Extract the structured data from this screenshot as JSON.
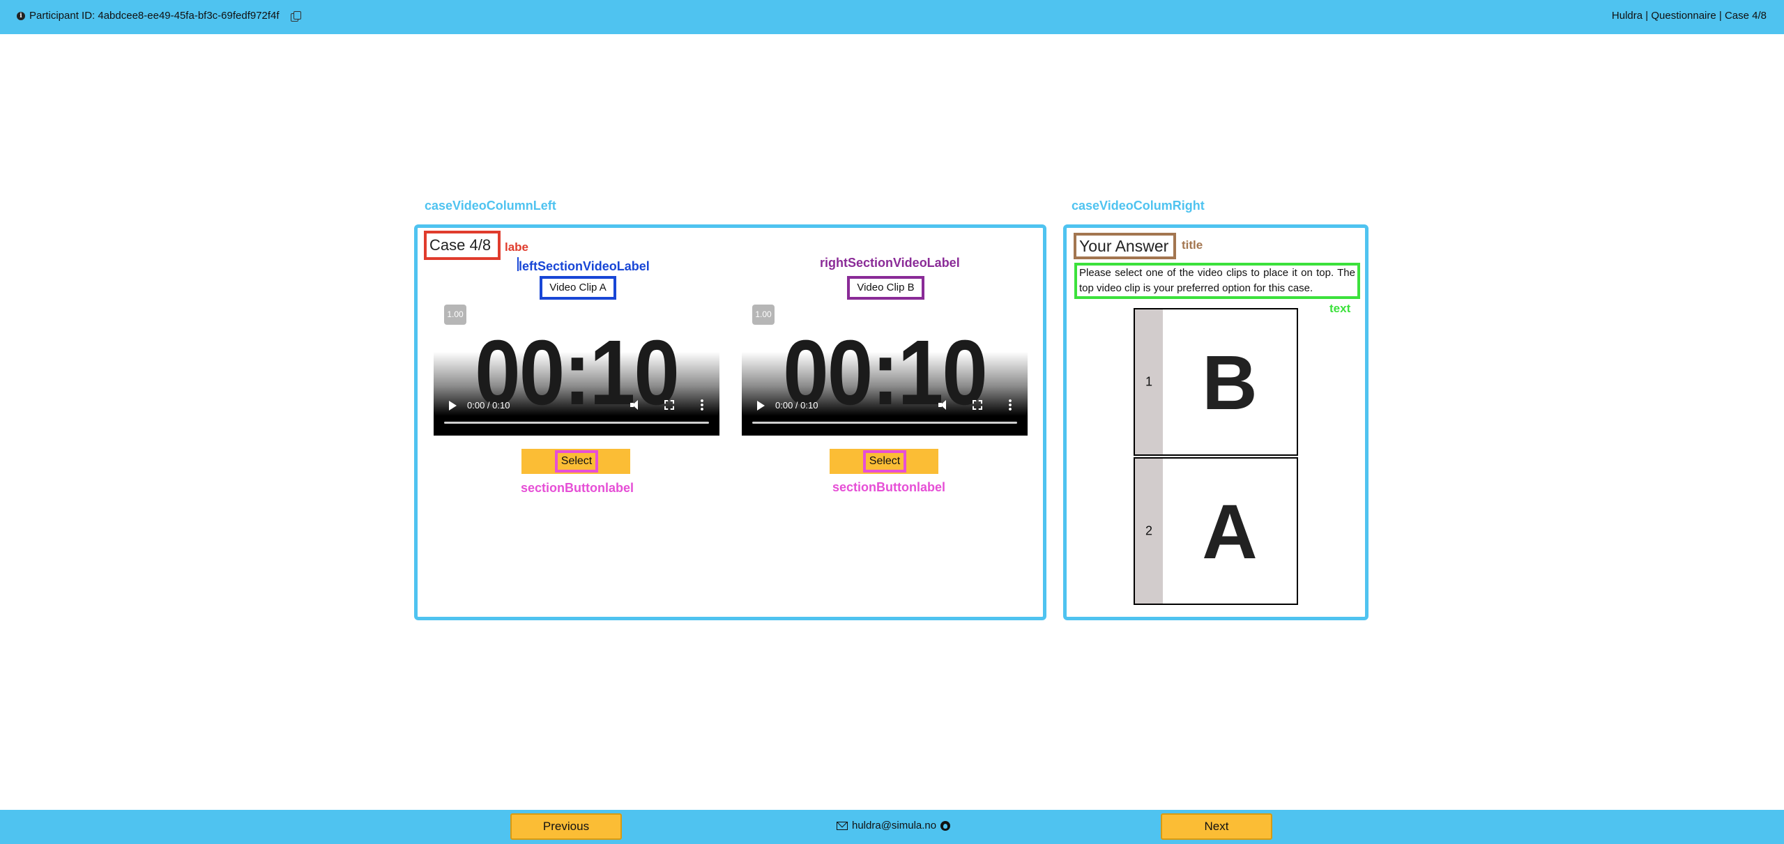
{
  "header": {
    "participant_id": "Participant ID: 4abdcee8-ee49-45fa-bf3c-69fedf972f4f",
    "breadcrumb": "Huldra | Questionnaire | Case 4/8"
  },
  "annotations": {
    "col_left": "caseVideoColumnLeft",
    "col_right": "caseVideoColumRight",
    "case_label": "labe",
    "left_video_label": "leftSectionVideoLabel",
    "right_video_label": "rightSectionVideoLabel",
    "section_button_label_a": "sectionButtonlabel",
    "section_button_label_b": "sectionButtonlabel",
    "title": "title",
    "text": "text"
  },
  "annotation_colors": {
    "column": "#4fc3f0",
    "case_label": "#e03c2d",
    "left_video_label": "#1846d6",
    "right_video_label": "#8a2b97",
    "button_label": "#e64fd6",
    "title": "#a37650",
    "text": "#3ce13c"
  },
  "case": {
    "label": "Case 4/8"
  },
  "videos": [
    {
      "label": "Video Clip A",
      "rate": "1.00",
      "display": "00:10",
      "time": "0:00 / 0:10",
      "button": "Select"
    },
    {
      "label": "Video Clip B",
      "rate": "1.00",
      "display": "00:10",
      "time": "0:00 / 0:10",
      "button": "Select"
    }
  ],
  "answer": {
    "title": "Your Answer",
    "text": "Please select one of the video clips to place it on top. The top video clip is your preferred option for this case.",
    "ranking": [
      {
        "rank": "1",
        "clip": "B"
      },
      {
        "rank": "2",
        "clip": "A"
      }
    ]
  },
  "footer": {
    "previous": "Previous",
    "email": "huldra@simula.no",
    "next": "Next"
  },
  "colors": {
    "bar": "#4fc3f0",
    "button": "#fbbd35"
  },
  "icons": [
    "info-icon",
    "copy-icon",
    "play-icon",
    "volume-icon",
    "fullscreen-icon",
    "more-icon",
    "mail-icon",
    "github-icon"
  ]
}
